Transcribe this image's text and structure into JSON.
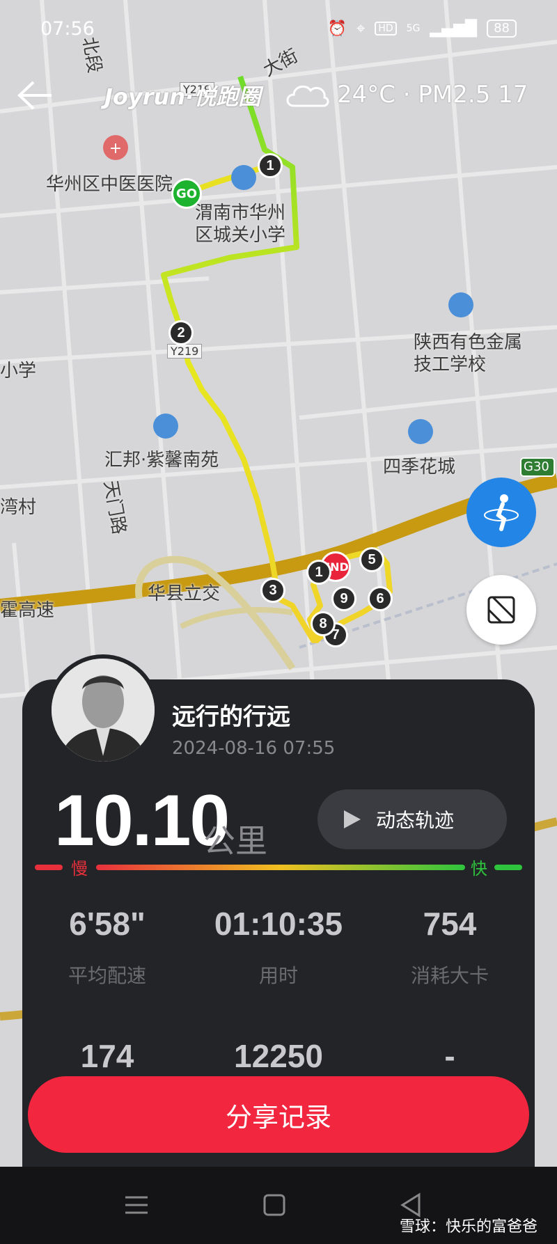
{
  "status": {
    "time": "07:56",
    "network": "5G",
    "battery": "88"
  },
  "header": {
    "brand": "Joyrun·悦跑圈",
    "weather": "24°C · PM2.5 17"
  },
  "map": {
    "labels": [
      "大街",
      "北段",
      "华州区中医医院",
      "渭南市华州区城关小学",
      "陕西有色金属技工学校",
      "小学",
      "汇邦·紫馨南苑",
      "四季花城",
      "G30",
      "天门路",
      "湾村",
      "华县立交",
      "霍高速",
      "Y219",
      "Y219"
    ],
    "markers": [
      "1",
      "2",
      "3",
      "5",
      "6",
      "7",
      "8",
      "9",
      "1"
    ],
    "go": "GO",
    "end": "END"
  },
  "run": {
    "username": "远行的行远",
    "datetime": "2024-08-16 07:55",
    "distance": "10.10",
    "unit": "公里",
    "replay_label": "动态轨迹",
    "slow": "慢",
    "fast": "快",
    "stats": [
      {
        "value": "6'58\"",
        "label": "平均配速"
      },
      {
        "value": "01:10:35",
        "label": "用时"
      },
      {
        "value": "754",
        "label": "消耗大卡"
      },
      {
        "value": "174",
        "label": ""
      },
      {
        "value": "12250",
        "label": ""
      },
      {
        "value": "-",
        "label": ""
      }
    ]
  },
  "share_label": "分享记录",
  "watermark": "雪球：快乐的富爸爸",
  "colors": {
    "accent": "#f2263f",
    "fab": "#2386e6",
    "slow": "#e8303d",
    "fast": "#2fc43d"
  }
}
